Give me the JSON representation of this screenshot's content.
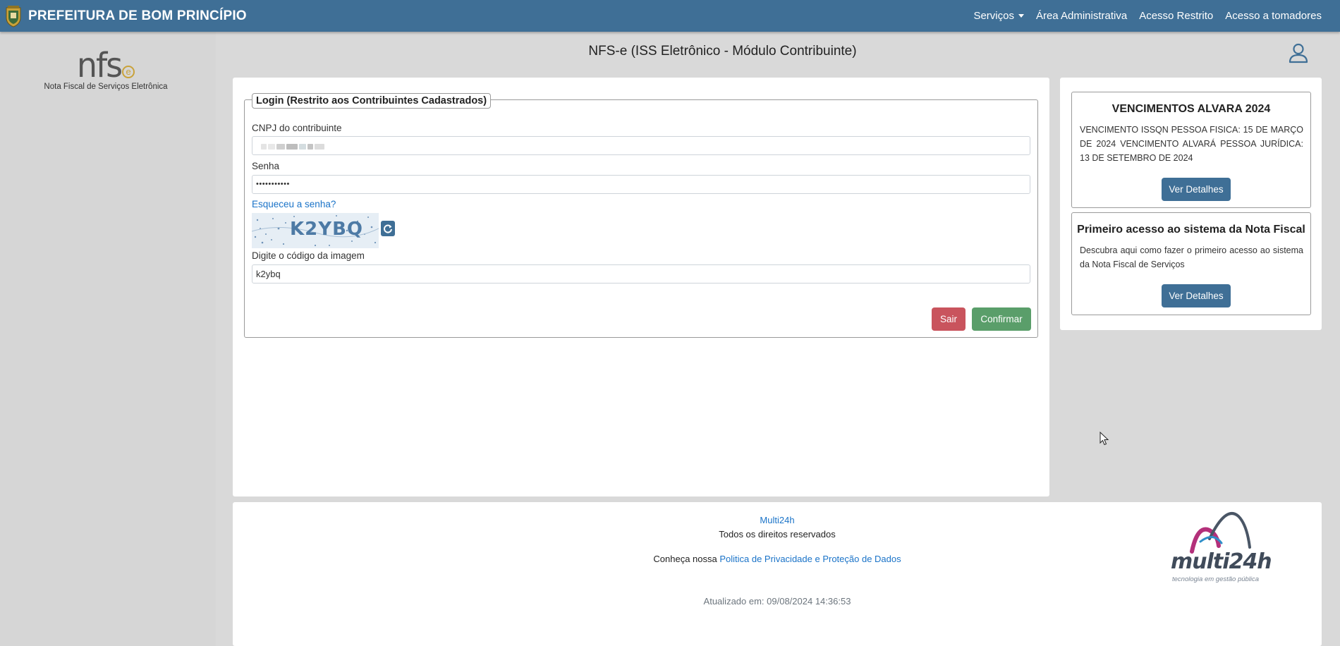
{
  "navbar": {
    "title": "PREFEITURA DE BOM PRINCÍPIO",
    "links": {
      "servicos": "Serviços",
      "area_administrativa": "Área Administrativa",
      "acesso_restrito": "Acesso Restrito",
      "acesso_tomadores": "Acesso a tomadores"
    }
  },
  "sidebar": {
    "logo_letters": "nfs",
    "logo_e": "e",
    "logo_caption": "Nota Fiscal de Serviços Eletrônica"
  },
  "page": {
    "title": "NFS-e (ISS Eletrônico - Módulo Contribuinte)"
  },
  "login": {
    "legend": "Login (Restrito aos Contribuintes Cadastrados)",
    "cnpj_label": "CNPJ do contribuinte",
    "senha_label": "Senha",
    "senha_value": "•••••••••••",
    "forgot_link": "Esqueceu a senha?",
    "captcha_text": "K2YBQ",
    "captcha_label": "Digite o código da imagem",
    "captcha_value": "k2ybq",
    "sair_button": "Sair",
    "confirmar_button": "Confirmar"
  },
  "notices": [
    {
      "title": "VENCIMENTOS ALVARA 2024",
      "text": "VENCIMENTO ISSQN PESSOA FISICA: 15 DE MARÇO DE 2024 VENCIMENTO ALVARÁ PESSOA JURÍDICA: 13 DE SETEMBRO DE 2024",
      "button": "Ver Detalhes"
    },
    {
      "title": "Primeiro acesso ao sistema da Nota Fiscal",
      "text": "Descubra aqui como fazer o primeiro acesso ao sistema da Nota Fiscal de Serviços",
      "button": "Ver Detalhes"
    }
  ],
  "footer": {
    "company_link": "Multi24h",
    "rights": "Todos os direitos reservados",
    "privacy_prefix": "Conheça nossa ",
    "privacy_link": "Politica de Privacidade e Proteção de Dados",
    "updated": "Atualizado em: 09/08/2024 14:36:53",
    "logo_word": "multi24h",
    "logo_tagline": "tecnologia em gestão pública"
  },
  "colors": {
    "navbar": "#3f6f96",
    "danger": "#c9545d",
    "success": "#5a9e6a",
    "link": "#1a73c8"
  }
}
